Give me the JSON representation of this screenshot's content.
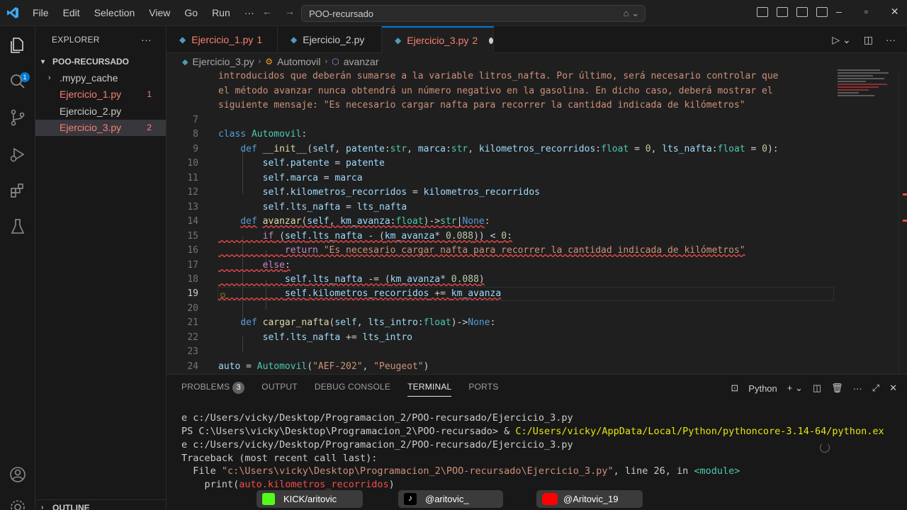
{
  "titlebar": {
    "menu": [
      "File",
      "Edit",
      "Selection",
      "View",
      "Go",
      "Run",
      "···"
    ],
    "search": "POO-recursado"
  },
  "sidebar": {
    "title": "EXPLORER",
    "folder": "POO-RECURSADO",
    "items": [
      {
        "label": ".mypy_cache",
        "count": ""
      },
      {
        "label": "Ejercicio_1.py",
        "count": "1"
      },
      {
        "label": "Ejercicio_2.py",
        "count": ""
      },
      {
        "label": "Ejercicio_3.py",
        "count": "2"
      }
    ],
    "outline": "OUTLINE"
  },
  "tabs": [
    {
      "label": "Ejercicio_1.py",
      "count": "1"
    },
    {
      "label": "Ejercicio_2.py",
      "count": ""
    },
    {
      "label": "Ejercicio_3.py",
      "count": "2"
    }
  ],
  "breadcrumb": [
    "Ejercicio_3.py",
    "Automovil",
    "avanzar"
  ],
  "editor": {
    "doc_lines": [
      "introducidos que deberán sumarse a la variable litros_nafta. Por último, será necesario controlar que",
      "el método avanzar nunca obtendrá un número negativo en la gasolina. En dicho caso, deberá mostrar el",
      "siguiente mensaje: \"Es necesario cargar nafta para recorrer la cantidad indicada de kilómetros\""
    ],
    "line_numbers": [
      "7",
      "8",
      "9",
      "10",
      "11",
      "12",
      "13",
      "14",
      "15",
      "16",
      "17",
      "18",
      "19",
      "20",
      "21",
      "22",
      "23",
      "24"
    ]
  },
  "panel": {
    "tabs": [
      "PROBLEMS",
      "OUTPUT",
      "DEBUG CONSOLE",
      "TERMINAL",
      "PORTS"
    ],
    "problems_count": "3",
    "shell": "Python",
    "terminal": [
      "e c:/Users/vicky/Desktop/Programacion_2/POO-recursado/Ejercicio_3.py",
      "PS C:\\Users\\vicky\\Desktop\\Programacion_2\\POO-recursado> & C:/Users/vicky/AppData/Local/Python/pythoncore-3.14-64/python.ex",
      "e c:/Users/vicky/Desktop/Programacion_2/POO-recursado/Ejercicio_3.py",
      "Traceback (most recent call last):",
      "  File \"c:\\Users\\vicky\\Desktop\\Programacion_2\\POO-recursado\\Ejercicio_3.py\", line 26, in <module>",
      "    print(auto.kilometros_recorridos)"
    ]
  },
  "overlay": [
    {
      "label": "KICK/aritovic",
      "color": "#53fc18"
    },
    {
      "label": "@aritovic_",
      "color": "#000000"
    },
    {
      "label": "@Aritovic_19",
      "color": "#ff0000"
    }
  ]
}
